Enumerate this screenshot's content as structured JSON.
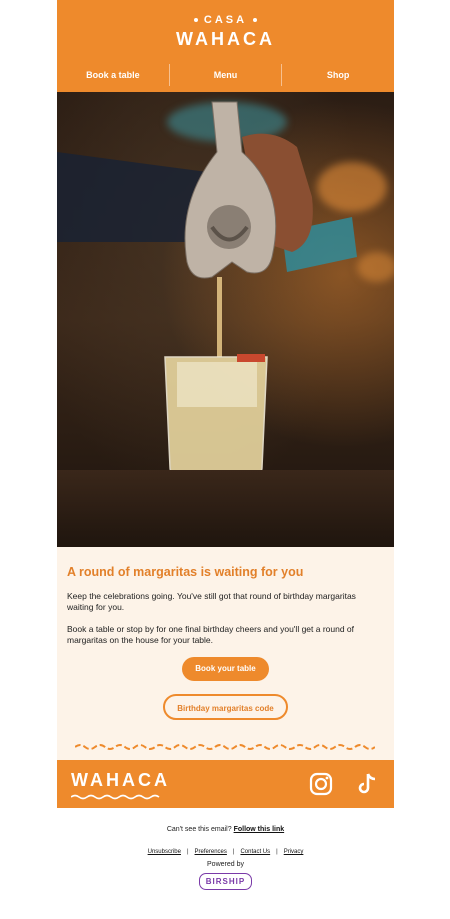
{
  "brand": {
    "top": "CASA",
    "main": "WAHACA"
  },
  "nav": {
    "items": [
      "Book a table",
      "Menu",
      "Shop"
    ]
  },
  "content": {
    "headline": "A round of margaritas is waiting for you",
    "paragraph_1": "Keep the celebrations going. You've still got that round of birthday margaritas waiting for you.",
    "paragraph_2": "Book a table or stop by for one final birthday cheers and you'll get a round of margaritas on the house for your table.",
    "primary_cta": "Book your table",
    "secondary_cta": "Birthday margaritas code"
  },
  "footer": {
    "logo": "WAHACA",
    "social": [
      "instagram-icon",
      "tiktok-icon"
    ]
  },
  "bottom": {
    "cant_see": "Can't see this email?",
    "follow_link": "Follow this link",
    "links": [
      "Unsubscribe",
      "Preferences",
      "Contact Us",
      "Privacy"
    ],
    "powered_by": "Powered by",
    "powered_brand": "BIRSHIP"
  },
  "colors": {
    "brand_orange": "#ee8a2c",
    "cream": "#fdf3e8",
    "accent_purple": "#7a3aa8"
  }
}
